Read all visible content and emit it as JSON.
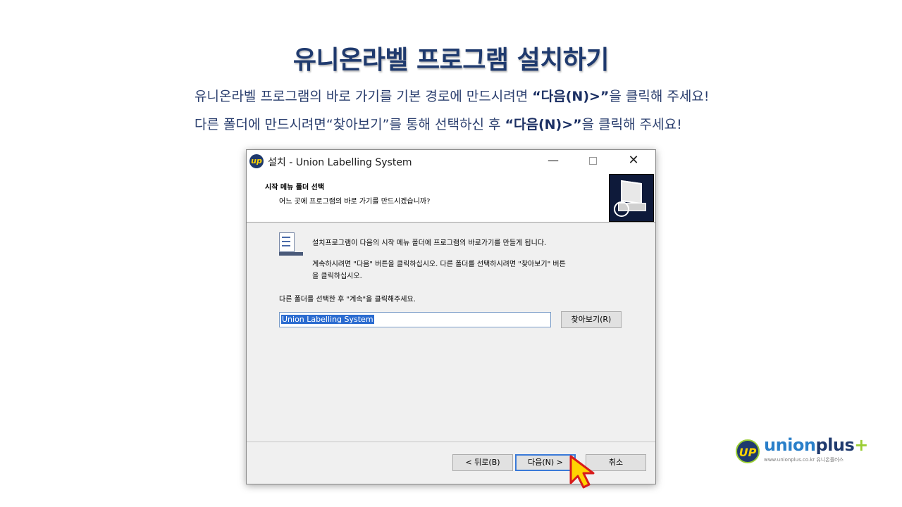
{
  "slide": {
    "title": "유니온라벨 프로그램 설치하기",
    "line1_pre": "유니온라벨 프로그램의 바로 가기를 기본 경로에 만드시려면 ",
    "line1_bold": "“다음(N)>”",
    "line1_post": "을 클릭해 주세요!",
    "line2_pre": "다른 폴더에 만드시려면“찾아보기”를 통해 선택하신 후 ",
    "line2_bold": "“다음(N)>”",
    "line2_post": "을 클릭해 주세요!"
  },
  "window": {
    "title": "설치 - Union Labelling System",
    "min_label": "—",
    "close_label": "✕"
  },
  "header": {
    "title": "시작 메뉴 폴더 선택",
    "subtitle": "어느 곳에 프로그램의 바로 가기를 만드시겠습니까?"
  },
  "content": {
    "line1": "설치프로그램이 다음의 시작 메뉴 폴더에 프로그램의 바로가기를 만들게 됩니다.",
    "line2": "계속하시려면 \"다음\" 버튼을 클릭하십시오. 다른 폴더를 선택하시려면 \"찾아보기\" 버튼",
    "line3": "을 클릭하십시오.",
    "line4": "다른 폴더를 선택한 후 \"계속\"을 클릭해주세요.",
    "folder_value": "Union Labelling System",
    "browse_label": "찾아보기(R)"
  },
  "footer": {
    "back_label": "< 뒤로(B)",
    "next_label": "다음(N) >",
    "cancel_label": "취소"
  },
  "logo": {
    "mark": "UP",
    "word_union": "union",
    "word_plus": "plus",
    "plus_sign": "+",
    "url_text": "www.unionplus.co.kr  유니온플러스"
  },
  "colors": {
    "title": "#1f3a6e",
    "accent": "#ffd400",
    "selection": "#2a6bd0"
  }
}
